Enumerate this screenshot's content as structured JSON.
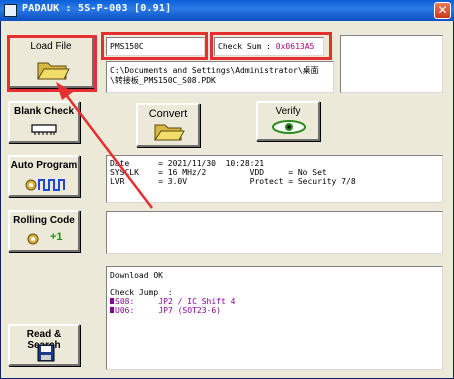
{
  "window": {
    "title": "PADAUK : 5S-P-003 [0.91]",
    "close_glyph": "✕"
  },
  "buttons": {
    "load_file": "Load File",
    "blank_check": "Blank Check",
    "auto_program": "Auto Program",
    "rolling_code": "Rolling Code",
    "rolling_code_suffix": "+1",
    "read_search": "Read & Search",
    "convert": "Convert",
    "verify": "Verify"
  },
  "file": {
    "ic_name": "PMS150C",
    "checksum_label": "Check Sum : ",
    "checksum_value": "0x0613A5",
    "path_line1": "C:\\Documents and Settings\\Administrator\\桌面",
    "path_line2": "\\转接板_PMS150C_S08.PDK"
  },
  "info": {
    "date_line": "Date      = 2021/11/30  10:28:21",
    "sysclk_line": "SYSCLK    = 16 MHz/2         VDD     = No Set",
    "lvr_line": "LVR       = 3.0V             Protect = Security 7/8"
  },
  "log": {
    "status": "Download OK",
    "check_jump": "Check Jump  :",
    "s08_prefix": "S08:",
    "s08_text": "     JP2 / IC Shift 4",
    "u06_prefix": "U06:",
    "u06_text": "     JP7 (SOT23-6)"
  },
  "icons": {
    "load_file": "folder-icon",
    "blank_check": "chip-icon",
    "auto_program": "auto-program-icon",
    "rolling_code": "rolling-code-icon",
    "read_search": "floppy-disk-icon",
    "convert": "convert-folder-icon",
    "verify": "verify-eye-icon"
  },
  "colors": {
    "titlebar": "#0a5fd8",
    "window_bg": "#ece9d8",
    "checksum_value": "#b0007a",
    "log_highlight": "#8a009a",
    "annotation_red": "#e63030",
    "icon_green": "#2a8a1a",
    "icon_blue": "#1a4ad6"
  }
}
